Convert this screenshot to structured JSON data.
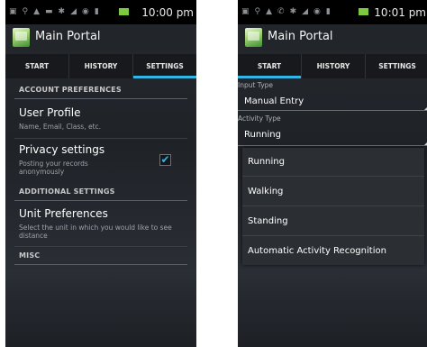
{
  "left_screen": {
    "status_bar": {
      "time": "10:00 pm"
    },
    "app_title": "Main Portal",
    "tabs": [
      "START",
      "HISTORY",
      "SETTINGS"
    ],
    "active_tab": "SETTINGS",
    "sections": {
      "account": "ACCOUNT PREFERENCES",
      "additional": "ADDITIONAL SETTINGS",
      "misc": "MISC"
    },
    "prefs": {
      "user_profile": {
        "title": "User Profile",
        "subtitle": "Name, Email, Class, etc."
      },
      "privacy": {
        "title": "Privacy settings",
        "subtitle": "Posting your records anonymously",
        "checked": true
      },
      "units": {
        "title": "Unit Preferences",
        "subtitle": "Select the unit in which you would like to see distance"
      }
    }
  },
  "right_screen": {
    "status_bar": {
      "time": "10:01 pm"
    },
    "app_title": "Main Portal",
    "tabs": [
      "START",
      "HISTORY",
      "SETTINGS"
    ],
    "active_tab": "START",
    "input_type": {
      "label": "Input Type",
      "value": "Manual Entry"
    },
    "activity_type": {
      "label": "Activity Type",
      "value": "Running"
    },
    "dropdown_options": [
      "Running",
      "Walking",
      "Standing",
      "Automatic Activity Recognition"
    ]
  },
  "colors": {
    "accent": "#33b5e5",
    "status_green": "#7fc940",
    "background": "#22252a"
  },
  "icons": [
    "app-icon",
    "checkmark-icon",
    "spinner-corner-icon"
  ]
}
